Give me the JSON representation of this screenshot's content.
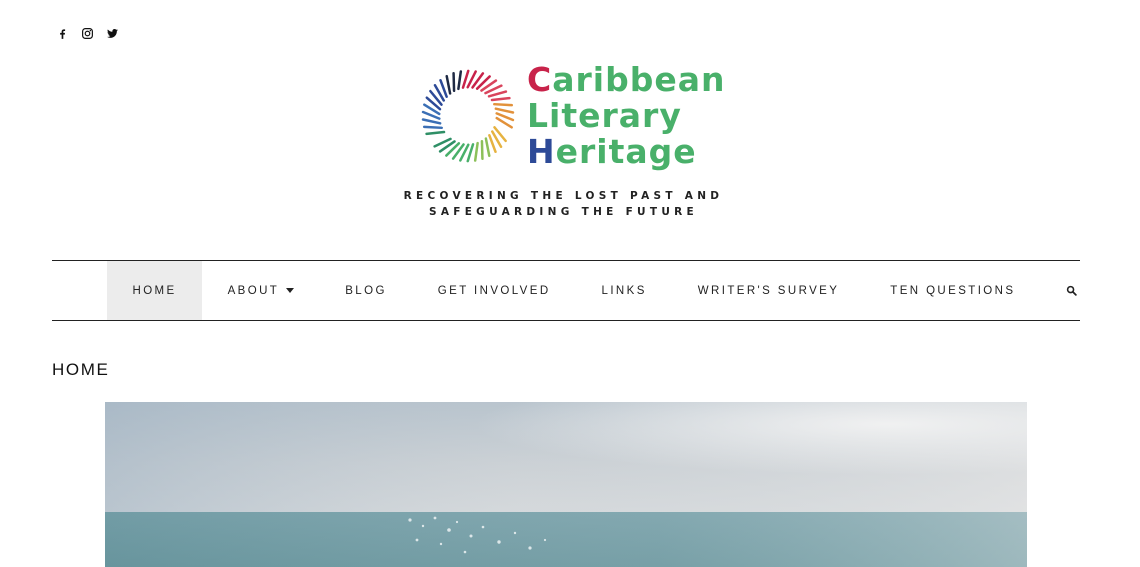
{
  "social": {
    "facebook_icon": "facebook-icon",
    "instagram_icon": "instagram-icon",
    "twitter_icon": "twitter-icon"
  },
  "logo": {
    "line1": "Caribbean",
    "line2": "Literary",
    "line3": "Heritage",
    "colors": [
      "#c8234a",
      "#e2913a",
      "#3e9a4e",
      "#49b06a",
      "#2d4a97",
      "#1f2a44"
    ]
  },
  "tagline": {
    "line1": "RECOVERING THE LOST PAST AND",
    "line2": "SAFEGUARDING THE FUTURE"
  },
  "nav": {
    "items": [
      {
        "label": "HOME"
      },
      {
        "label": "ABOUT"
      },
      {
        "label": "BLOG"
      },
      {
        "label": "GET INVOLVED"
      },
      {
        "label": "LINKS"
      },
      {
        "label": "WRITER'S SURVEY"
      },
      {
        "label": "TEN QUESTIONS"
      }
    ],
    "active": "HOME",
    "search_icon": "search-icon"
  },
  "page": {
    "title": "HOME"
  }
}
